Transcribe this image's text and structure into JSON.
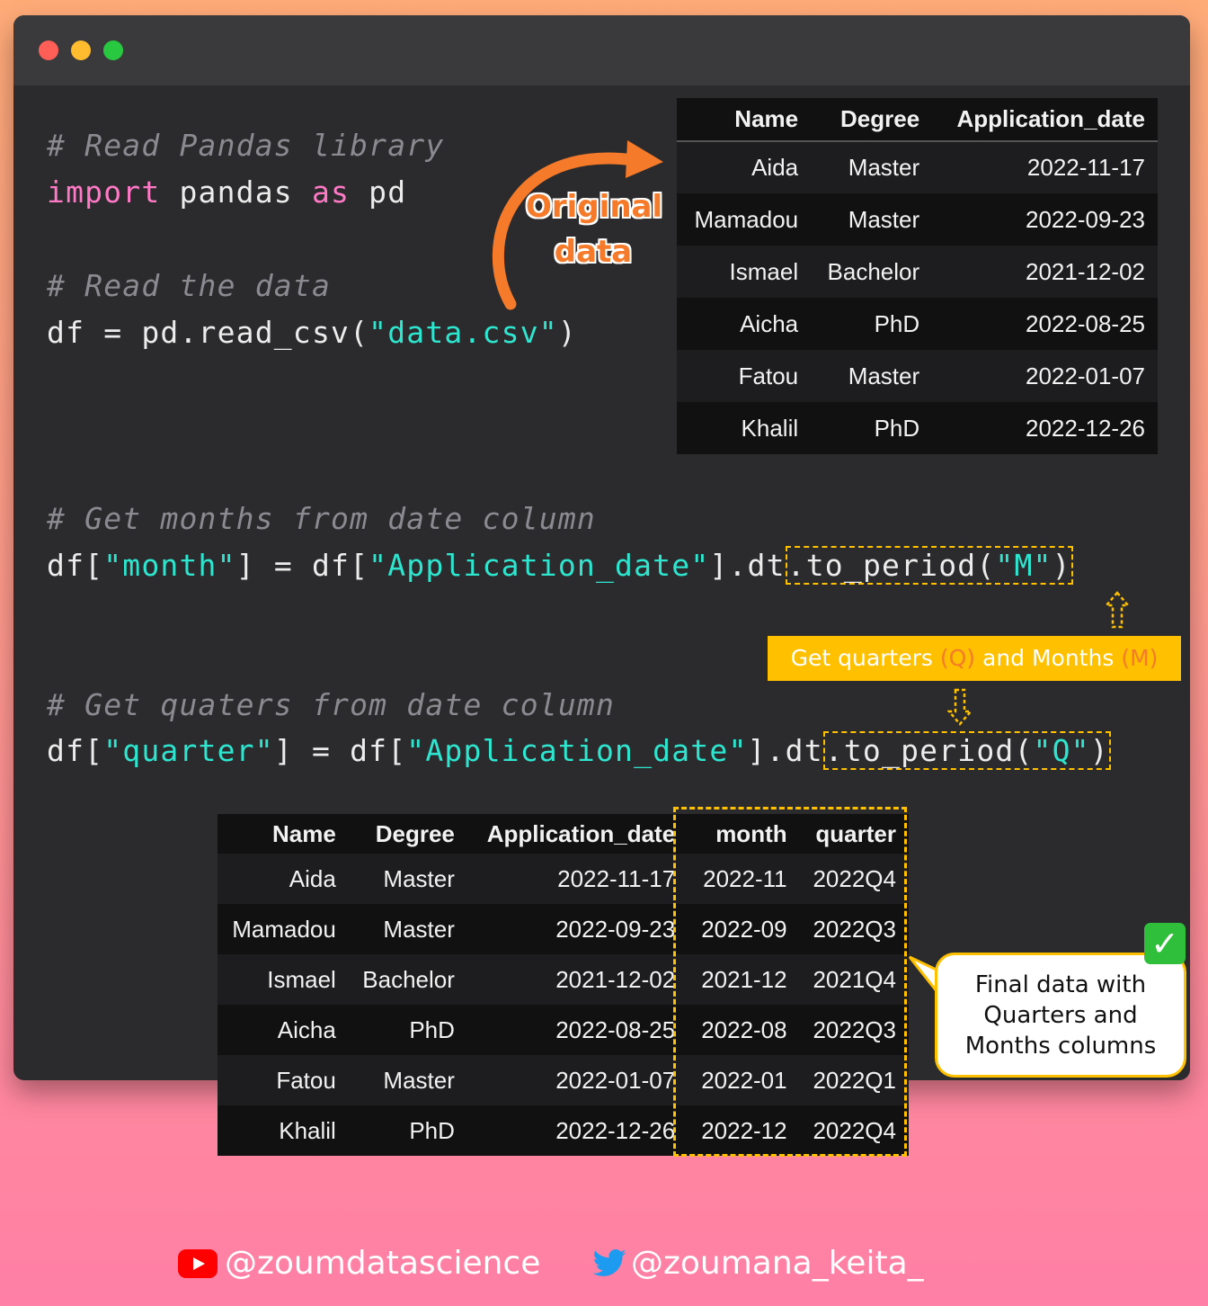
{
  "window": {
    "buttons": [
      "close",
      "minimize",
      "maximize"
    ]
  },
  "code": {
    "comment1": "# Read Pandas library",
    "import_kw": "import",
    "import_mod": " pandas ",
    "as_kw": "as",
    "import_alias": " pd",
    "comment2": "# Read the data",
    "read_pre": "df = pd.read_csv(",
    "read_str": "\"data.csv\"",
    "read_post": ")",
    "comment3": "# Get months from date column",
    "month_pre1": "df[",
    "month_str1": "\"month\"",
    "month_mid": "] = df[",
    "month_str2": "\"Application_date\"",
    "month_mid2": "].dt",
    "month_hl_pre": ".to_period(",
    "month_hl_str": "\"M\"",
    "month_hl_post": ")",
    "comment4": "# Get quaters from date column",
    "quarter_pre1": "df[",
    "quarter_str1": "\"quarter\"",
    "quarter_mid": "] = df[",
    "quarter_str2": "\"Application_date\"",
    "quarter_mid2": "].dt",
    "quarter_hl_pre": ".to_period(",
    "quarter_hl_str": "\"Q\"",
    "quarter_hl_post": ")"
  },
  "annotations": {
    "original_line1": "Original",
    "original_line2": "data",
    "banner_a": "Get quarters ",
    "banner_q": "(Q)",
    "banner_b": " and Months ",
    "banner_m": "(M)",
    "bubble_line1": "Final data with",
    "bubble_line2": "Quarters and",
    "bubble_line3": "Months columns",
    "check": "✓"
  },
  "original_table": {
    "headers": [
      "Name",
      "Degree",
      "Application_date"
    ],
    "rows": [
      [
        "Aida",
        "Master",
        "2022-11-17"
      ],
      [
        "Mamadou",
        "Master",
        "2022-09-23"
      ],
      [
        "Ismael",
        "Bachelor",
        "2021-12-02"
      ],
      [
        "Aicha",
        "PhD",
        "2022-08-25"
      ],
      [
        "Fatou",
        "Master",
        "2022-01-07"
      ],
      [
        "Khalil",
        "PhD",
        "2022-12-26"
      ]
    ]
  },
  "final_table": {
    "headers": [
      "Name",
      "Degree",
      "Application_date",
      "month",
      "quarter"
    ],
    "rows": [
      [
        "Aida",
        "Master",
        "2022-11-17",
        "2022-11",
        "2022Q4"
      ],
      [
        "Mamadou",
        "Master",
        "2022-09-23",
        "2022-09",
        "2022Q3"
      ],
      [
        "Ismael",
        "Bachelor",
        "2021-12-02",
        "2021-12",
        "2021Q4"
      ],
      [
        "Aicha",
        "PhD",
        "2022-08-25",
        "2022-08",
        "2022Q3"
      ],
      [
        "Fatou",
        "Master",
        "2022-01-07",
        "2022-01",
        "2022Q1"
      ],
      [
        "Khalil",
        "PhD",
        "2022-12-26",
        "2022-12",
        "2022Q4"
      ]
    ]
  },
  "footer": {
    "youtube_handle": "@zoumdatascience",
    "twitter_handle": "@zoumana_keita_"
  },
  "colors": {
    "accent_yellow": "#ffc000",
    "accent_orange": "#f57a2a",
    "string_teal": "#2ee6cf",
    "keyword_pink": "#ff79c6"
  }
}
